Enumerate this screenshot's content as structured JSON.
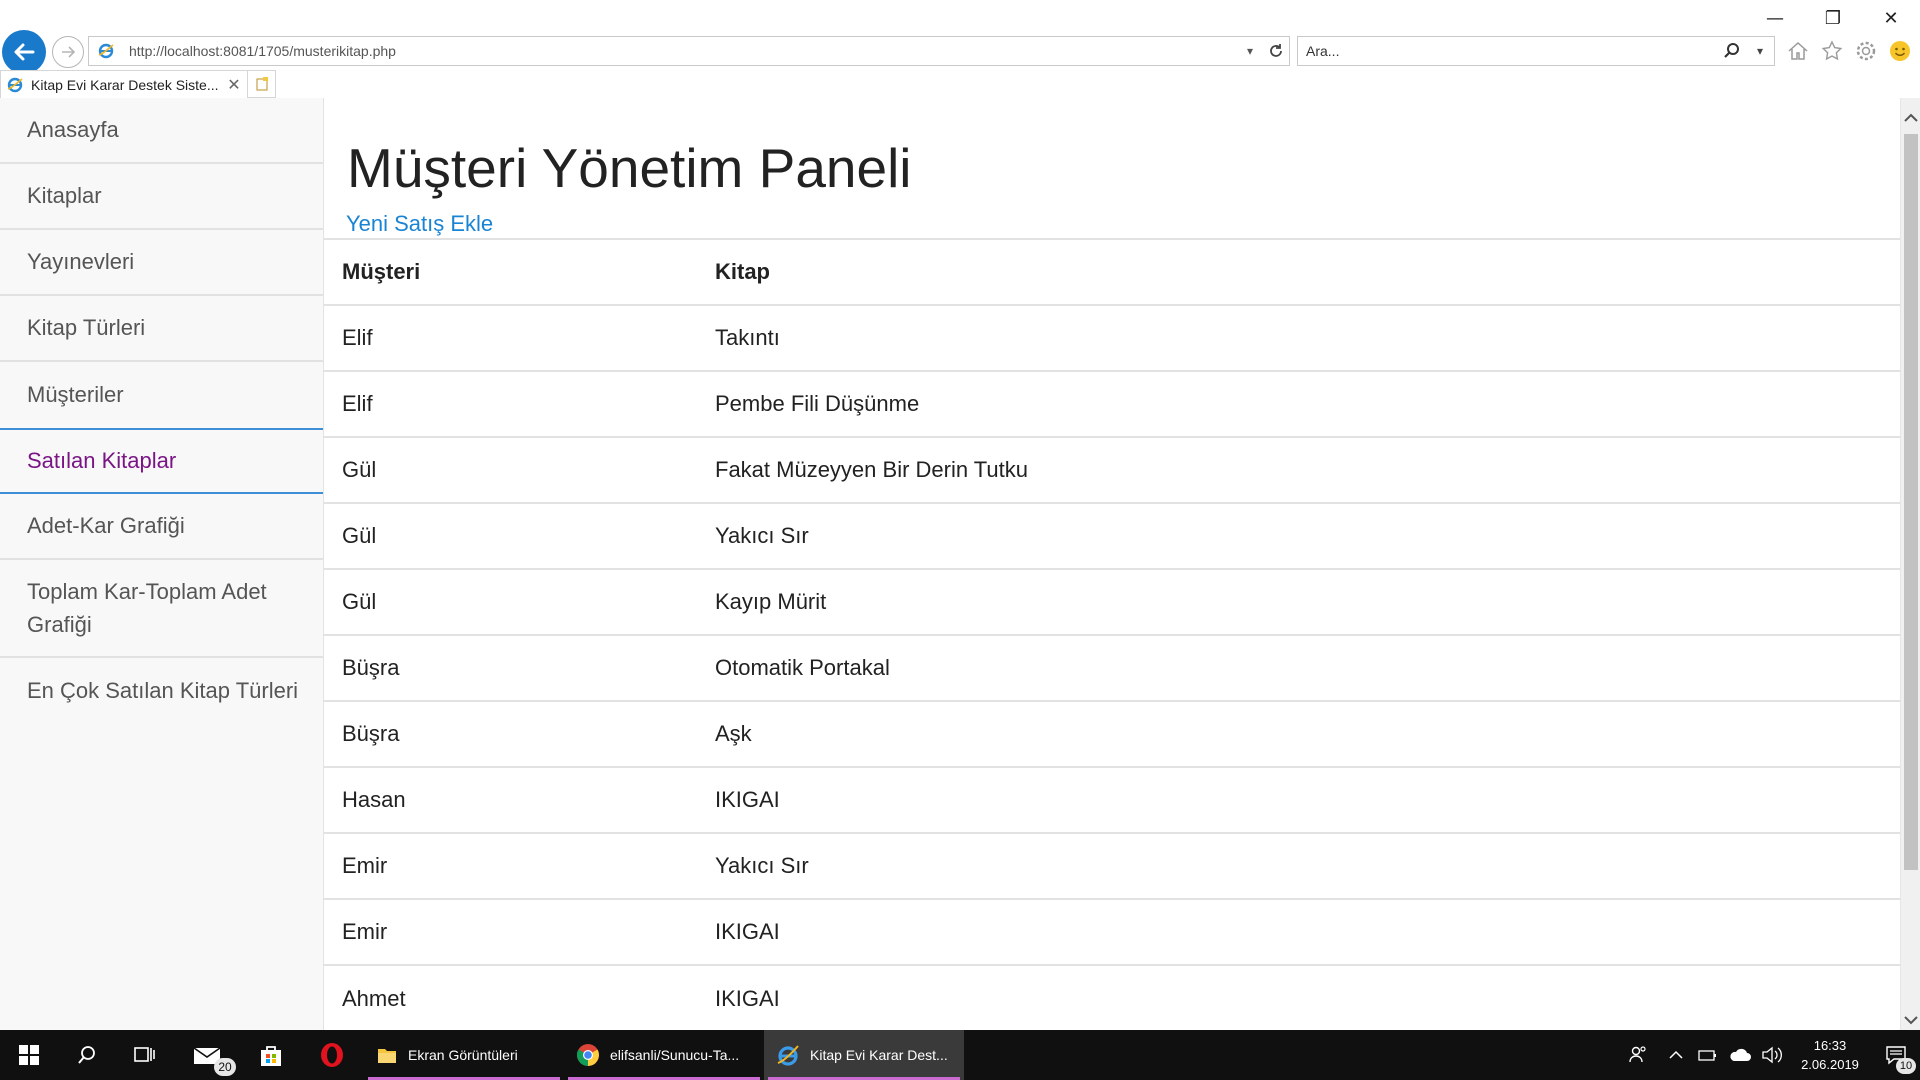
{
  "window": {
    "minimize_glyph": "—",
    "maximize_glyph": "❐",
    "close_glyph": "✕"
  },
  "browser": {
    "address": "http://localhost:8081/1705/musterikitap.php",
    "search_placeholder": "Ara...",
    "tab_title": "Kitap Evi Karar Destek Siste...",
    "tab_close": "✕",
    "accent_color": "#1979ca"
  },
  "sidebar": {
    "items": [
      {
        "label": "Anasayfa"
      },
      {
        "label": "Kitaplar"
      },
      {
        "label": "Yayınevleri"
      },
      {
        "label": "Kitap Türleri"
      },
      {
        "label": "Müşteriler"
      },
      {
        "label": "Satılan Kitaplar",
        "active": true
      },
      {
        "label": "Adet-Kar Grafiği"
      },
      {
        "label": "Toplam Kar-Toplam Adet Grafiği"
      },
      {
        "label": "En Çok Satılan Kitap Türleri"
      }
    ],
    "active_color": "#7a1585",
    "active_border_color": "#3d8fd6"
  },
  "main": {
    "title": "Müşteri Yönetim Paneli",
    "new_sale_link": "Yeni Satış Ekle",
    "link_color": "#1a84d4",
    "table": {
      "headers": [
        "Müşteri",
        "Kitap"
      ],
      "rows": [
        [
          "Elif",
          "Takıntı"
        ],
        [
          "Elif",
          "Pembe Fili Düşünme"
        ],
        [
          "Gül",
          "Fakat Müzeyyen Bir Derin Tutku"
        ],
        [
          "Gül",
          "Yakıcı Sır"
        ],
        [
          "Gül",
          "Kayıp Mürit"
        ],
        [
          "Büşra",
          "Otomatik Portakal"
        ],
        [
          "Büşra",
          "Aşk"
        ],
        [
          "Hasan",
          "IKIGAI"
        ],
        [
          "Emir",
          "Yakıcı Sır"
        ],
        [
          "Emir",
          "IKIGAI"
        ],
        [
          "Ahmet",
          "IKIGAI"
        ]
      ]
    }
  },
  "taskbar": {
    "mail_badge": "20",
    "apps": [
      {
        "label": "Ekran Görüntüleri",
        "icon": "folder-icon"
      },
      {
        "label": "elifsanli/Sunucu-Ta...",
        "icon": "chrome-icon"
      },
      {
        "label": "Kitap Evi Karar Dest...",
        "icon": "ie-icon",
        "active": true
      }
    ],
    "clock_time": "16:33",
    "clock_date": "2.06.2019",
    "notification_count": "10"
  }
}
